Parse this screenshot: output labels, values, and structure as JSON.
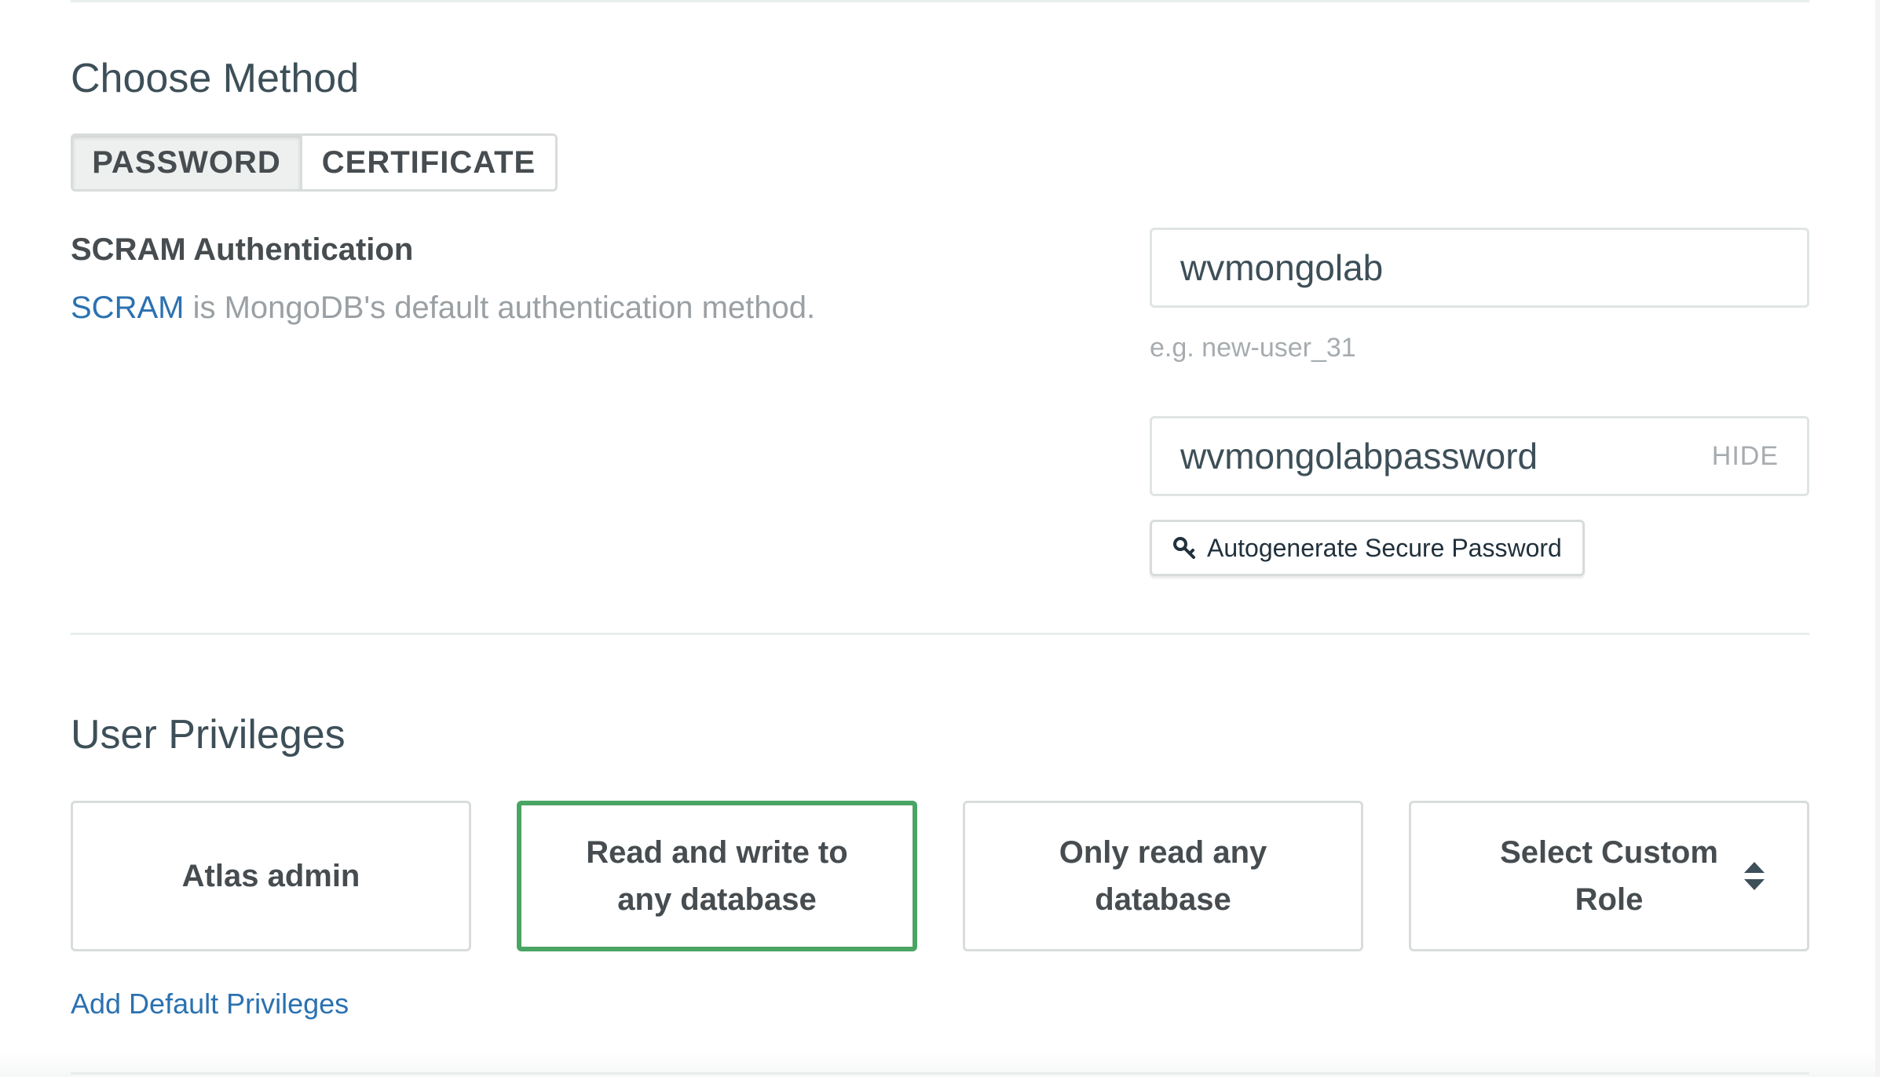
{
  "method": {
    "title": "Choose Method",
    "options": [
      "PASSWORD",
      "CERTIFICATE"
    ],
    "selected": "PASSWORD"
  },
  "auth": {
    "title": "SCRAM Authentication",
    "link_text": "SCRAM",
    "description": " is MongoDB's default authentication method."
  },
  "username": {
    "value": "wvmongolab",
    "hint": "e.g. new-user_31"
  },
  "password": {
    "value": "wvmongolabpassword",
    "toggle_label": "HIDE"
  },
  "autogen": {
    "label": "Autogenerate Secure Password",
    "icon": "key-icon"
  },
  "privileges": {
    "title": "User Privileges",
    "options": [
      {
        "label": "Atlas admin",
        "selected": false
      },
      {
        "label": "Read and write to any database",
        "selected": true
      },
      {
        "label": "Only read any database",
        "selected": false
      },
      {
        "label": "Select Custom Role",
        "selected": false,
        "icon": "sort-arrows-icon"
      }
    ],
    "add_link": "Add Default Privileges"
  },
  "colors": {
    "link": "#2b71b1",
    "selected_border": "#4aa564",
    "muted_text": "#9aa0a3"
  }
}
